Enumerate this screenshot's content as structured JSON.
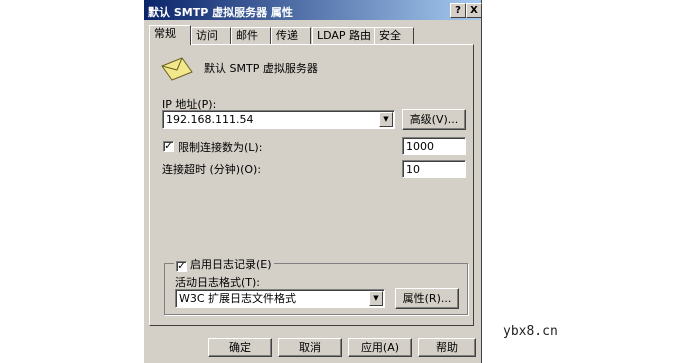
{
  "window": {
    "title": "默认 SMTP 虚拟服务器 属性",
    "help_btn": "?",
    "close_btn": "X"
  },
  "tabs": [
    {
      "label": "常规",
      "active": true
    },
    {
      "label": "访问"
    },
    {
      "label": "邮件"
    },
    {
      "label": "传递"
    },
    {
      "label": "LDAP 路由"
    },
    {
      "label": "安全"
    }
  ],
  "general": {
    "server_name": "默认 SMTP 虚拟服务器",
    "server_icon": "envelope-icon",
    "ip_label": "IP 地址(P):",
    "ip_value": "192.168.111.54",
    "advanced_button": "高级(V)...",
    "limit_connections_label": "限制连接数为(L):",
    "limit_connections_checked": true,
    "limit_connections_value": "1000",
    "timeout_label": "连接超时 (分钟)(O):",
    "timeout_value": "10",
    "logging_label": "启用日志记录(E)",
    "logging_checked": true,
    "log_format_label": "活动日志格式(T):",
    "log_format_value": "W3C 扩展日志文件格式",
    "properties_button": "属性(R)..."
  },
  "footer": {
    "ok": "确定",
    "cancel": "取消",
    "apply": "应用(A)",
    "help": "帮助"
  },
  "watermark": "ybx8.cn"
}
